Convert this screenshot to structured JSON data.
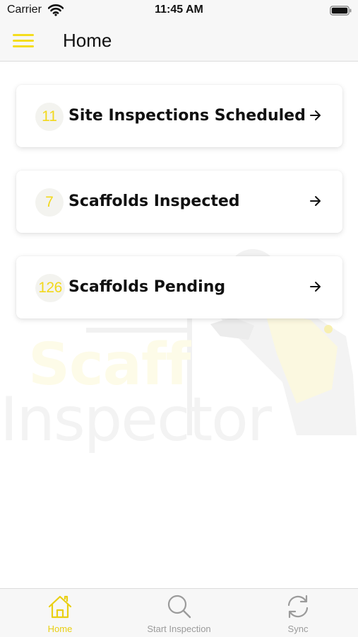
{
  "status_bar": {
    "carrier": "Carrier",
    "time": "11:45 AM"
  },
  "header": {
    "title": "Home",
    "menu_icon": "hamburger-menu-icon"
  },
  "cards": [
    {
      "count": "11",
      "label": "Site Inspections Scheduled",
      "icon": "arrow-right-icon"
    },
    {
      "count": "7",
      "label": "Scaffolds Inspected",
      "icon": "arrow-right-icon"
    },
    {
      "count": "126",
      "label": "Scaffolds Pending",
      "icon": "arrow-right-icon"
    }
  ],
  "watermark": {
    "line1": "Scaff",
    "line2": "Inspector"
  },
  "tabs": [
    {
      "label": "Home",
      "icon": "home-icon",
      "active": true
    },
    {
      "label": "Start Inspection",
      "icon": "search-icon",
      "active": false
    },
    {
      "label": "Sync",
      "icon": "sync-icon",
      "active": false
    }
  ],
  "colors": {
    "accent": "#f2d81c",
    "inactive": "#9b9b9b",
    "bar_background": "#f7f7f7"
  }
}
